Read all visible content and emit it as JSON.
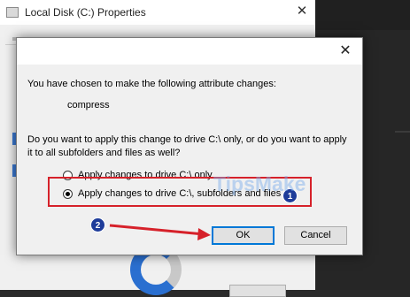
{
  "background_window": {
    "title": "Local Disk (C:) Properties",
    "close_glyph": "✕"
  },
  "dialog": {
    "close_glyph": "✕",
    "intro": "You have chosen to make the following attribute changes:",
    "change": "compress",
    "question_line1": "Do you want to apply this change to drive C:\\ only, or do you want to apply",
    "question_line2": "it to all subfolders and files as well?",
    "options": [
      {
        "label": "Apply changes to drive C:\\ only",
        "selected": false
      },
      {
        "label": "Apply changes to drive C:\\, subfolders and files",
        "selected": true
      }
    ],
    "ok_label": "OK",
    "cancel_label": "Cancel"
  },
  "annotations": {
    "step1": "1",
    "step2": "2",
    "highlight_color": "#d6212a",
    "badge_color": "#1e3c9a"
  },
  "watermark": "TipsMake"
}
